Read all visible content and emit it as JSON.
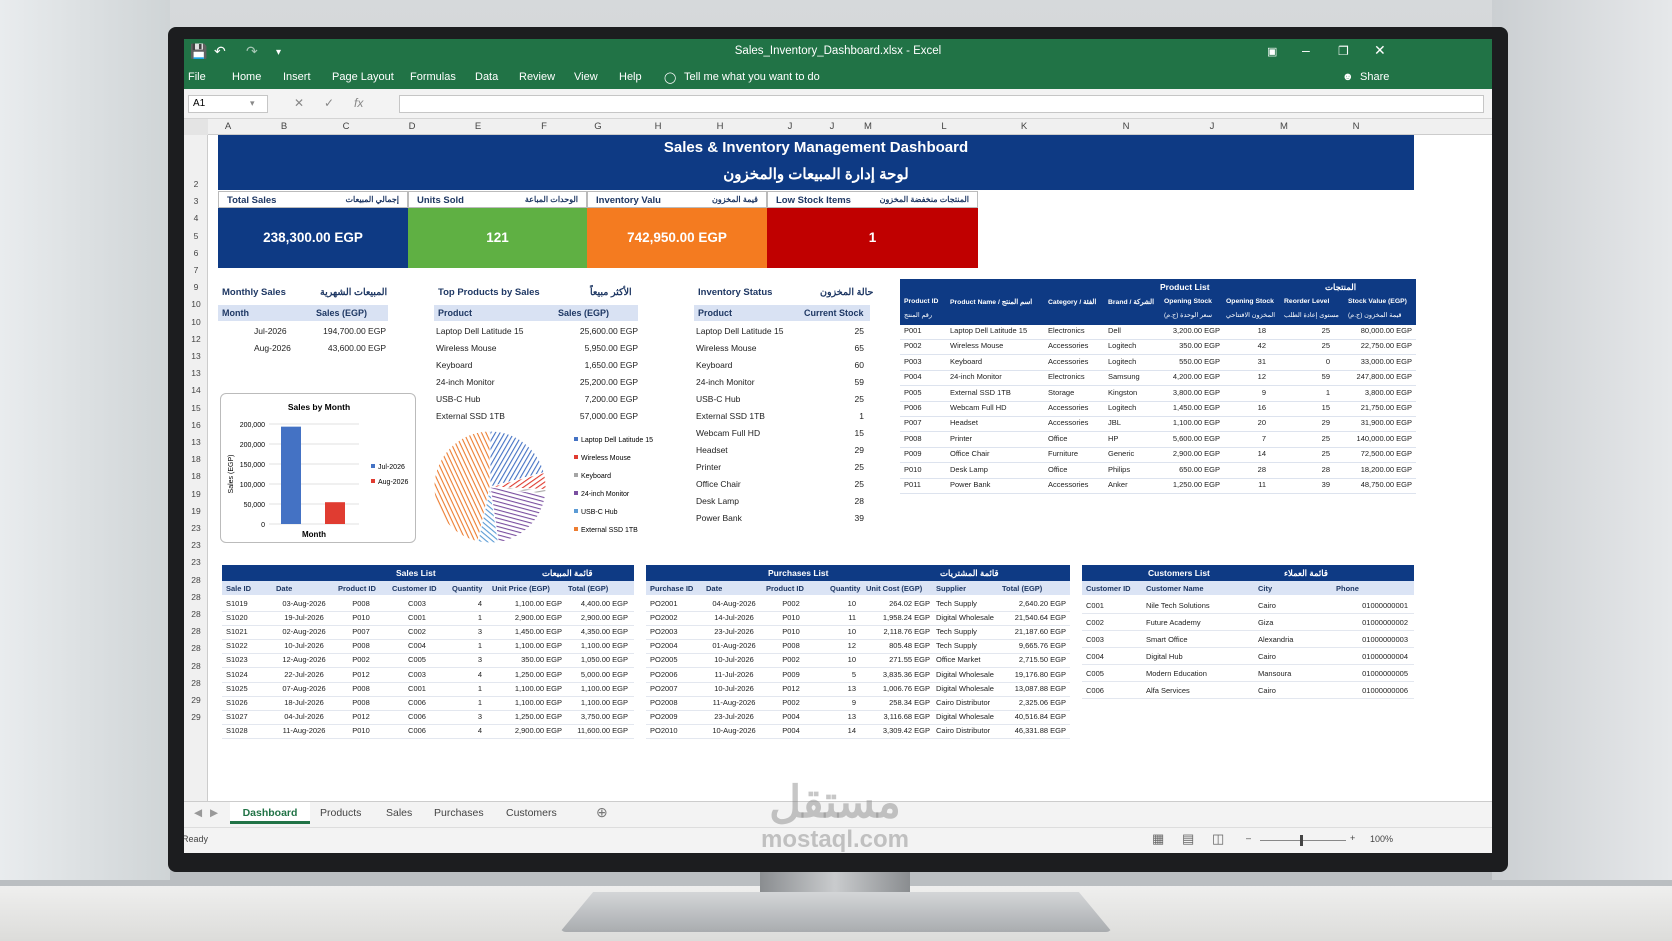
{
  "window": {
    "title": "Sales_Inventory_Dashboard.xlsx - Excel"
  },
  "ribbon": {
    "tabs": [
      "File",
      "Home",
      "Insert",
      "Page Layout",
      "Formulas",
      "Data",
      "Review",
      "View",
      "Help"
    ],
    "tell_me": "Tell me what you want to do",
    "share": "Share"
  },
  "formula": {
    "namebox": "A1"
  },
  "columns": [
    "A",
    "B",
    "C",
    "D",
    "E",
    "F",
    "G",
    "H",
    "H",
    "J",
    "J",
    "M",
    "L",
    "K",
    "N",
    "J",
    "M",
    "N"
  ],
  "rows": [
    "2",
    "3",
    "4",
    "5",
    "6",
    "7",
    "9",
    "10",
    "10",
    "12",
    "13",
    "13",
    "14",
    "15",
    "16",
    "13",
    "18",
    "18",
    "19",
    "19",
    "23",
    "23",
    "23",
    "28",
    "28",
    "28",
    "28",
    "28",
    "28",
    "28",
    "29",
    "29"
  ],
  "dashboard": {
    "title_en": "Sales & Inventory Management Dashboard",
    "title_ar": "لوحة إدارة المبيعات والمخزون",
    "kpis": [
      {
        "label_en": "Total Sales",
        "label_ar": "إجمالي المبيعات",
        "value": "238,300.00 EGP",
        "color": "#0e3a84"
      },
      {
        "label_en": "Units Sold",
        "label_ar": "الوحدات المباعة",
        "value": "121",
        "color": "#5fb043"
      },
      {
        "label_en": "Inventory Valu",
        "label_ar": "قيمة المخزون",
        "value": "742,950.00 EGP",
        "color": "#f47b20"
      },
      {
        "label_en": "Low Stock Items",
        "label_ar": "المنتجات منخفضة المخزون",
        "value": "1",
        "color": "#c00000"
      }
    ]
  },
  "monthly": {
    "title_en": "Monthly Sales",
    "title_ar": "المبيعات الشهرية",
    "headers": [
      "Month",
      "Sales (EGP)"
    ],
    "rows": [
      [
        "Jul-2026",
        "194,700.00 EGP"
      ],
      [
        "Aug-2026",
        "43,600.00 EGP"
      ]
    ]
  },
  "top_products": {
    "title_en": "Top Products by Sales",
    "title_ar": "الأكثر مبيعاً",
    "headers": [
      "Product",
      "Sales (EGP)"
    ],
    "rows": [
      [
        "Laptop Dell Latitude 15",
        "25,600.00 EGP"
      ],
      [
        "Wireless Mouse",
        "5,950.00 EGP"
      ],
      [
        "Keyboard",
        "1,650.00 EGP"
      ],
      [
        "24-inch Monitor",
        "25,200.00 EGP"
      ],
      [
        "USB-C Hub",
        "7,200.00 EGP"
      ],
      [
        "External SSD 1TB",
        "57,000.00 EGP"
      ]
    ]
  },
  "inventory_status": {
    "title_en": "Inventory Status",
    "title_ar": "حالة المخزون",
    "headers": [
      "Product",
      "Current Stock"
    ],
    "rows": [
      [
        "Laptop Dell Latitude 15",
        "25"
      ],
      [
        "Wireless Mouse",
        "65"
      ],
      [
        "Keyboard",
        "60"
      ],
      [
        "24-inch Monitor",
        "59"
      ],
      [
        "USB-C Hub",
        "25"
      ],
      [
        "External SSD 1TB",
        "1"
      ],
      [
        "Webcam Full HD",
        "15"
      ],
      [
        "Headset",
        "29"
      ],
      [
        "Printer",
        "25"
      ],
      [
        "Office Chair",
        "25"
      ],
      [
        "Desk Lamp",
        "28"
      ],
      [
        "Power Bank",
        "39"
      ]
    ]
  },
  "chart_data": [
    {
      "type": "bar",
      "title": "Sales by Month",
      "xlabel": "Month",
      "ylabel": "Sales (EGP)",
      "categories": [
        "Month"
      ],
      "series": [
        {
          "name": "Jul-2026",
          "values": [
            194700
          ],
          "color": "#4472c4"
        },
        {
          "name": "Aug-2026",
          "values": [
            43600
          ],
          "color": "#e03c31"
        }
      ],
      "ylim": [
        0,
        200000
      ],
      "yticks": [
        "200,000",
        "200,000",
        "150,000",
        "100,000",
        "50,000",
        "0"
      ],
      "legend": "right",
      "grid": true
    },
    {
      "type": "pie",
      "labels": [
        "Laptop Dell Latitude 15",
        "Wireless Mouse",
        "Keyboard",
        "24-inch Monitor",
        "USB-C Hub",
        "External SSD 1TB"
      ],
      "values": [
        25600,
        5950,
        1650,
        25200,
        7200,
        57000
      ],
      "colors": [
        "#4472c4",
        "#e03c31",
        "#a5a5a5",
        "#7a4fa0",
        "#5b9bd5",
        "#ed7d31"
      ],
      "legend": "right"
    }
  ],
  "product_list": {
    "title_en": "Product List",
    "title_ar": "المنتجات",
    "headers": [
      "Product ID",
      "Product Name / اسم المنتج",
      "Category / الفئة",
      "Brand / الشركة",
      "Opening Stock",
      "Opening Stock",
      "Reorder Level",
      "Stock Value (EGP)"
    ],
    "subheaders": [
      "رقم المنتج",
      "",
      "",
      "",
      "سعر الوحدة (ج.م)",
      "المخزون الافتتاحي",
      "مستوى إعادة الطلب",
      "قيمة المخزون (ج.م)"
    ],
    "rows": [
      [
        "P001",
        "Laptop Dell Latitude 15",
        "Electronics",
        "Dell",
        "3,200.00 EGP",
        "18",
        "25",
        "80,000.00 EGP"
      ],
      [
        "P002",
        "Wireless Mouse",
        "Accessories",
        "Logitech",
        "350.00 EGP",
        "42",
        "25",
        "22,750.00 EGP"
      ],
      [
        "P003",
        "Keyboard",
        "Accessories",
        "Logitech",
        "550.00 EGP",
        "31",
        "0",
        "33,000.00 EGP"
      ],
      [
        "P004",
        "24-inch Monitor",
        "Electronics",
        "Samsung",
        "4,200.00 EGP",
        "12",
        "59",
        "247,800.00 EGP"
      ],
      [
        "P005",
        "External SSD 1TB",
        "Storage",
        "Kingston",
        "3,800.00 EGP",
        "9",
        "1",
        "3,800.00 EGP"
      ],
      [
        "P006",
        "Webcam Full HD",
        "Accessories",
        "Logitech",
        "1,450.00 EGP",
        "16",
        "15",
        "21,750.00 EGP"
      ],
      [
        "P007",
        "Headset",
        "Accessories",
        "JBL",
        "1,100.00 EGP",
        "20",
        "29",
        "31,900.00 EGP"
      ],
      [
        "P008",
        "Printer",
        "Office",
        "HP",
        "5,600.00 EGP",
        "7",
        "25",
        "140,000.00 EGP"
      ],
      [
        "P009",
        "Office Chair",
        "Furniture",
        "Generic",
        "2,900.00 EGP",
        "14",
        "25",
        "72,500.00 EGP"
      ],
      [
        "P010",
        "Desk Lamp",
        "Office",
        "Philips",
        "650.00 EGP",
        "28",
        "28",
        "18,200.00 EGP"
      ],
      [
        "P011",
        "Power Bank",
        "Accessories",
        "Anker",
        "1,250.00 EGP",
        "11",
        "39",
        "48,750.00 EGP"
      ]
    ]
  },
  "sales_list": {
    "title_en": "Sales List",
    "title_ar": "قائمة المبيعات",
    "headers": [
      "Sale ID",
      "Date",
      "Product ID",
      "Customer ID",
      "Quantity",
      "Unit Price (EGP)",
      "Total (EGP)"
    ],
    "rows": [
      [
        "S1019",
        "03-Aug-2026",
        "P008",
        "C003",
        "4",
        "1,100.00 EGP",
        "4,400.00 EGP"
      ],
      [
        "S1020",
        "19-Jul-2026",
        "P010",
        "C001",
        "1",
        "2,900.00 EGP",
        "2,900.00 EGP"
      ],
      [
        "S1021",
        "02-Aug-2026",
        "P007",
        "C002",
        "3",
        "1,450.00 EGP",
        "4,350.00 EGP"
      ],
      [
        "S1022",
        "10-Jul-2026",
        "P008",
        "C004",
        "1",
        "1,100.00 EGP",
        "1,100.00 EGP"
      ],
      [
        "S1023",
        "12-Aug-2026",
        "P002",
        "C005",
        "3",
        "350.00 EGP",
        "1,050.00 EGP"
      ],
      [
        "S1024",
        "22-Jul-2026",
        "P012",
        "C003",
        "4",
        "1,250.00 EGP",
        "5,000.00 EGP"
      ],
      [
        "S1025",
        "07-Aug-2026",
        "P008",
        "C001",
        "1",
        "1,100.00 EGP",
        "1,100.00 EGP"
      ],
      [
        "S1026",
        "18-Jul-2026",
        "P008",
        "C006",
        "1",
        "1,100.00 EGP",
        "1,100.00 EGP"
      ],
      [
        "S1027",
        "04-Jul-2026",
        "P012",
        "C006",
        "3",
        "1,250.00 EGP",
        "3,750.00 EGP"
      ],
      [
        "S1028",
        "11-Aug-2026",
        "P010",
        "C006",
        "4",
        "2,900.00 EGP",
        "11,600.00 EGP"
      ]
    ]
  },
  "purchases_list": {
    "title_en": "Purchases List",
    "title_ar": "قائمة المشتريات",
    "headers": [
      "Purchase ID",
      "Date",
      "Product ID",
      "Quantity",
      "Unit Cost (EGP)",
      "Supplier",
      "Total (EGP)"
    ],
    "rows": [
      [
        "PO2001",
        "04-Aug-2026",
        "P002",
        "10",
        "264.02 EGP",
        "Tech Supply",
        "2,640.20 EGP"
      ],
      [
        "PO2002",
        "14-Jul-2026",
        "P010",
        "11",
        "1,958.24 EGP",
        "Digital Wholesale",
        "21,540.64 EGP"
      ],
      [
        "PO2003",
        "23-Jul-2026",
        "P010",
        "10",
        "2,118.76 EGP",
        "Tech Supply",
        "21,187.60 EGP"
      ],
      [
        "PO2004",
        "01-Aug-2026",
        "P008",
        "12",
        "805.48 EGP",
        "Tech Supply",
        "9,665.76 EGP"
      ],
      [
        "PO2005",
        "10-Jul-2026",
        "P002",
        "10",
        "271.55 EGP",
        "Office Market",
        "2,715.50 EGP"
      ],
      [
        "PO2006",
        "11-Jul-2026",
        "P009",
        "5",
        "3,835.36 EGP",
        "Digital Wholesale",
        "19,176.80 EGP"
      ],
      [
        "PO2007",
        "10-Jul-2026",
        "P012",
        "13",
        "1,006.76 EGP",
        "Digital Wholesale",
        "13,087.88 EGP"
      ],
      [
        "PO2008",
        "11-Aug-2026",
        "P002",
        "9",
        "258.34 EGP",
        "Cairo Distributor",
        "2,325.06 EGP"
      ],
      [
        "PO2009",
        "23-Jul-2026",
        "P004",
        "13",
        "3,116.68 EGP",
        "Digital Wholesale",
        "40,516.84 EGP"
      ],
      [
        "PO2010",
        "10-Aug-2026",
        "P004",
        "14",
        "3,309.42 EGP",
        "Cairo Distributor",
        "46,331.88 EGP"
      ]
    ]
  },
  "customers_list": {
    "title_en": "Customers List",
    "title_ar": "قائمة العملاء",
    "headers": [
      "Customer ID",
      "Customer Name",
      "City",
      "Phone"
    ],
    "rows": [
      [
        "C001",
        "Nile Tech Solutions",
        "Cairo",
        "01000000001"
      ],
      [
        "C002",
        "Future Academy",
        "Giza",
        "01000000002"
      ],
      [
        "C003",
        "Smart Office",
        "Alexandria",
        "01000000003"
      ],
      [
        "C004",
        "Digital Hub",
        "Cairo",
        "01000000004"
      ],
      [
        "C005",
        "Modern Education",
        "Mansoura",
        "01000000005"
      ],
      [
        "C006",
        "Alfa Services",
        "Cairo",
        "01000000006"
      ]
    ]
  },
  "sheets": [
    "Dashboard",
    "Products",
    "Sales",
    "Purchases",
    "Customers"
  ],
  "status": {
    "ready": "Ready",
    "zoom": "100%"
  },
  "watermark": {
    "ar": "مستقل",
    "en": "mostaql.com"
  }
}
